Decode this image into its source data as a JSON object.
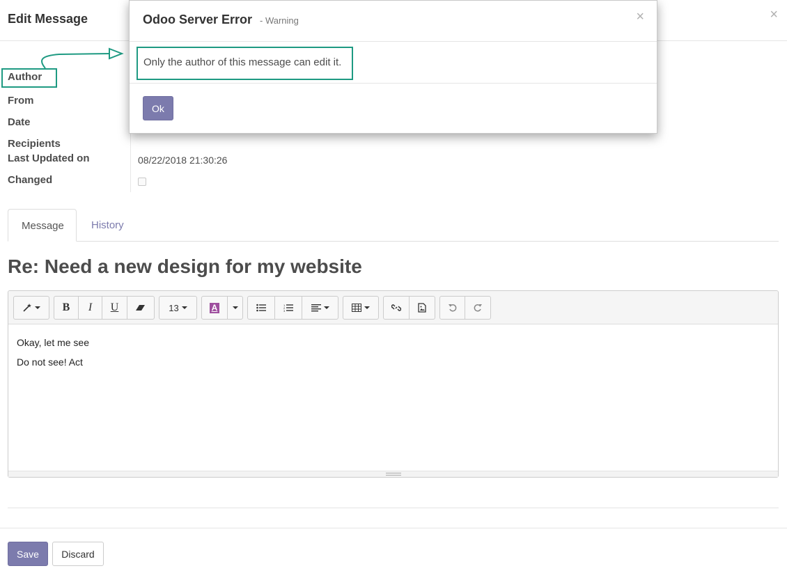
{
  "page": {
    "title": "Edit Message",
    "close_glyph": "×"
  },
  "fields": {
    "author_label": "Author",
    "from_label": "From",
    "date_label": "Date",
    "recipients_label": "Recipients",
    "last_updated_label": "Last Updated on",
    "last_updated_value": "08/22/2018 21:30:26",
    "changed_label": "Changed",
    "changed_checked": false
  },
  "tabs": [
    {
      "label": "Message",
      "active": true
    },
    {
      "label": "History",
      "active": false
    }
  ],
  "subject": "Re: Need a new design for my website",
  "editor": {
    "toolbar": {
      "style_icon": "magic-wand-icon",
      "bold": "B",
      "italic": "I",
      "underline": "U",
      "eraser_icon": "eraser-icon",
      "font_size": "13",
      "color_glyph": "A",
      "unordered_list_icon": "unordered-list-icon",
      "ordered_list_icon": "ordered-list-icon",
      "align_icon": "align-left-icon",
      "table_icon": "table-icon",
      "link_icon": "link-icon",
      "image_icon": "image-icon",
      "undo_icon": "undo-icon",
      "redo_icon": "redo-icon"
    },
    "lines": [
      "Okay, let me see",
      "Do not see! Act"
    ]
  },
  "buttons": {
    "save": "Save",
    "discard": "Discard"
  },
  "dialog": {
    "title": "Odoo Server Error",
    "subtitle": "- Warning",
    "message": "Only the author of this message can edit it.",
    "ok": "Ok",
    "close_glyph": "×"
  },
  "colors": {
    "primary": "#7c7bad",
    "annotation": "#1e9a82",
    "text": "#4c4c4c"
  }
}
